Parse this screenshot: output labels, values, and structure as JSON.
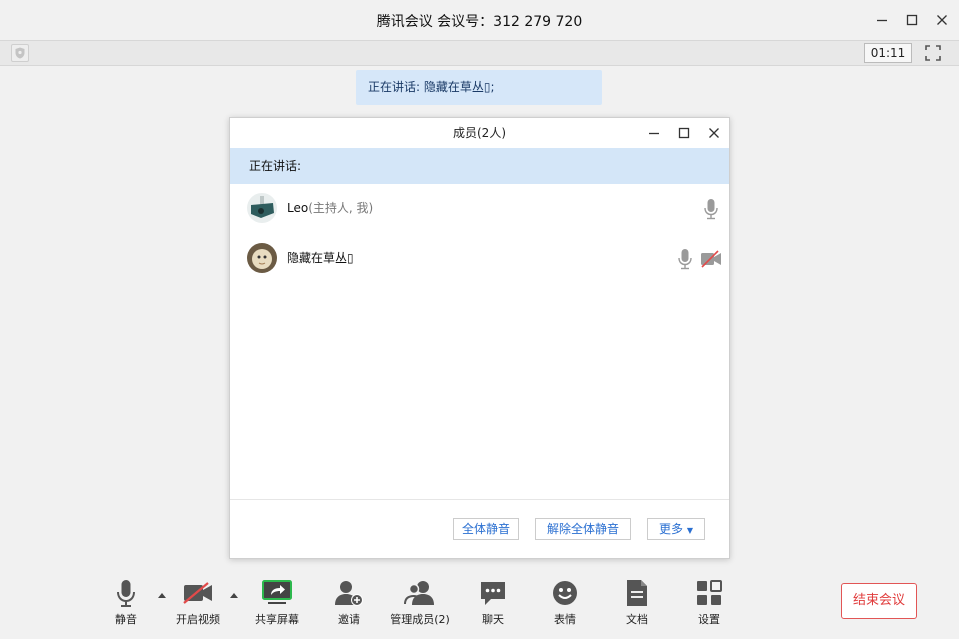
{
  "window": {
    "title": "腾讯会议 会议号：312 279 720"
  },
  "subbar": {
    "timer": "01:11"
  },
  "speaking_banner": "正在讲话: 隐藏在草丛▯;",
  "members_window": {
    "title": "成员(2人)",
    "speaking_label": "正在讲话:",
    "members": [
      {
        "name": "Leo",
        "role": "(主持人, 我)"
      },
      {
        "name": "隐藏在草丛▯",
        "role": ""
      }
    ],
    "footer": {
      "mute_all": "全体静音",
      "unmute_all": "解除全体静音",
      "more": "更多"
    }
  },
  "toolbar": {
    "mute": "静音",
    "video": "开启视频",
    "share": "共享屏幕",
    "invite": "邀请",
    "manage": "管理成员(2)",
    "chat": "聊天",
    "emoji": "表情",
    "docs": "文档",
    "settings": "设置",
    "end": "结束会议"
  },
  "colors": {
    "accent_blue": "#2a6fd1",
    "banner_bg": "#d6e7f9",
    "end_red": "#e03b3b",
    "share_green": "#2db84d"
  }
}
